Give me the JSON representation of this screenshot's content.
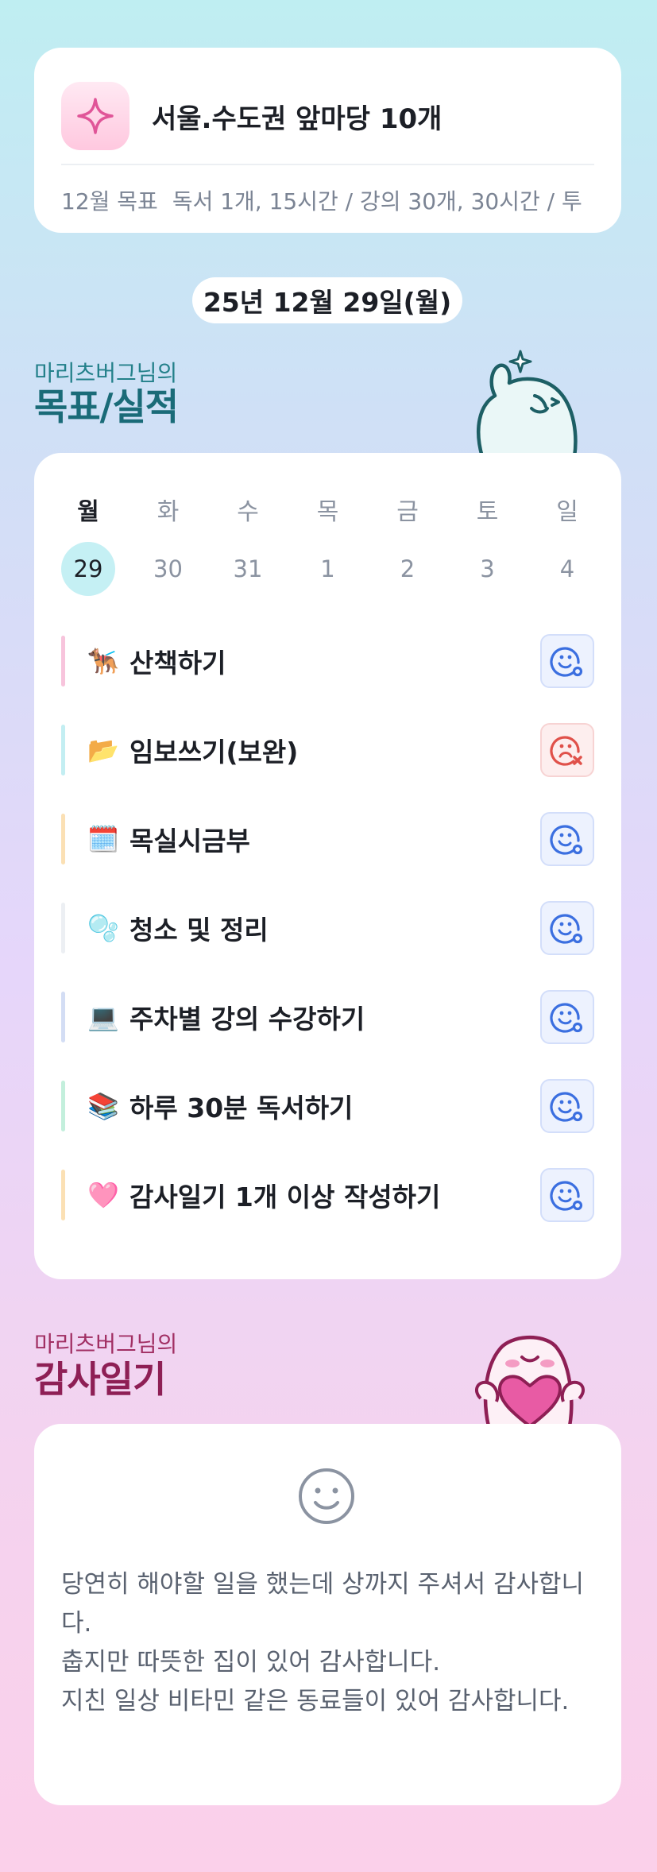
{
  "goal": {
    "title": "서울.수도권 앞마당 10개",
    "month_label": "12월 목표",
    "description": "독서 1개, 15시간 / 강의 30개, 30시간 / 투",
    "icon": "sparkle-icon"
  },
  "date": "25년 12월 29일(월)",
  "goals_section": {
    "subtitle": "마리츠버그님의",
    "title": "목표/실적"
  },
  "week": {
    "days": [
      {
        "name": "월",
        "num": "29",
        "active": true
      },
      {
        "name": "화",
        "num": "30"
      },
      {
        "name": "수",
        "num": "31"
      },
      {
        "name": "목",
        "num": "1"
      },
      {
        "name": "금",
        "num": "2"
      },
      {
        "name": "토",
        "num": "3"
      },
      {
        "name": "일",
        "num": "4"
      }
    ]
  },
  "tasks": [
    {
      "emoji": "🐕‍🦺",
      "label": "산책하기",
      "bar_color": "#f7c4dc",
      "status": "done"
    },
    {
      "emoji": "📂",
      "label": "임보쓰기(보완)",
      "bar_color": "#c3eef2",
      "status": "failed"
    },
    {
      "emoji": "🗓️",
      "label": "목실시금부",
      "bar_color": "#fbe0b4",
      "status": "done"
    },
    {
      "emoji": "🫧",
      "label": "청소 및 정리",
      "bar_color": "#eceff3",
      "status": "done"
    },
    {
      "emoji": "💻",
      "label": "주차별 강의 수강하기",
      "bar_color": "#d3ddf4",
      "status": "done"
    },
    {
      "emoji": "📚",
      "label": "하루 30분 독서하기",
      "bar_color": "#c3efdc",
      "status": "done"
    },
    {
      "emoji": "🩷",
      "label": "감사일기 1개 이상 작성하기",
      "bar_color": "#fbe0b4",
      "status": "done"
    }
  ],
  "gratitude_section": {
    "subtitle": "마리츠버그님의",
    "title": "감사일기"
  },
  "gratitude": {
    "icon": "smile-icon",
    "lines": [
      "당연히 해야할 일을 했는데 상까지 주셔서 감사합니다.",
      "춥지만 따뜻한 집이 있어 감사합니다.",
      "지친 일상 비타민 같은 동료들이 있어 감사합니다."
    ]
  },
  "colors": {
    "teal_title": "#1a6b78",
    "magenta_title": "#8e1f55",
    "done_icon": "#3b6fe0",
    "failed_icon": "#e0514a"
  }
}
